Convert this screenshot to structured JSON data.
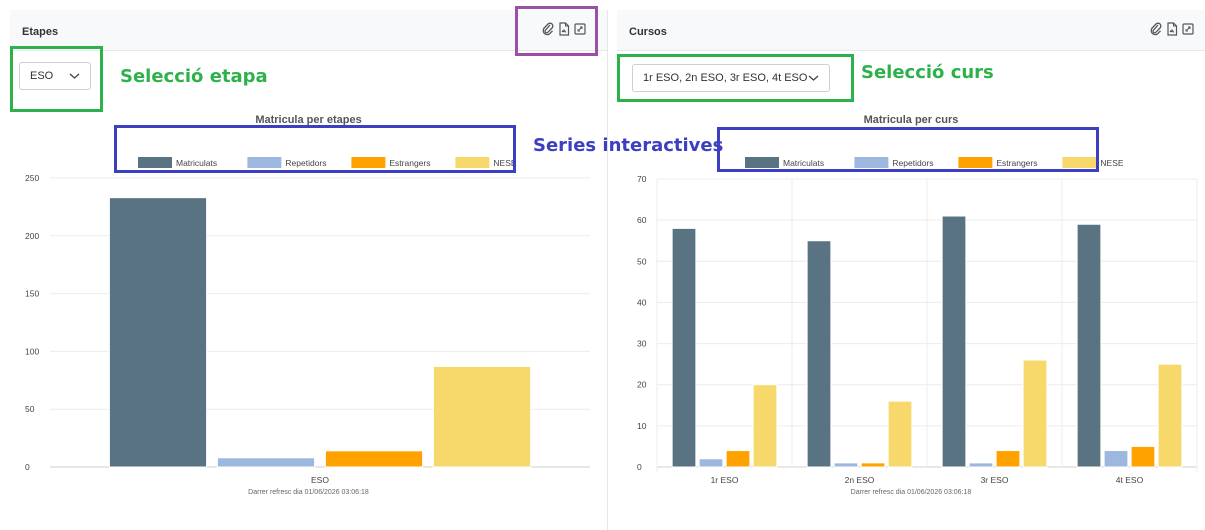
{
  "left": {
    "title": "Etapes",
    "select_value": "ESO",
    "chart_title": "Matricula per etapes",
    "footer": "Darrer refresc dia 01/06/2026 03:06:18"
  },
  "right": {
    "title": "Cursos",
    "select_value": "1r ESO, 2n ESO, 3r ESO, 4t ESO",
    "chart_title": "Matricula per curs",
    "footer": "Darrer refresc dia 01/06/2026 03:06:18"
  },
  "annotations": {
    "etapa": "Selecció etapa",
    "curs": "Selecció curs",
    "series": "Series interactives"
  },
  "icons": [
    "paperclip-icon",
    "pdf-icon",
    "expand-icon"
  ],
  "colors": {
    "Matriculats": "#5a7382",
    "Repetidors": "#9db7de",
    "Estrangers": "#ffa200",
    "NESE": "#f7d96b",
    "annot_green": "#2db24b",
    "annot_blue": "#3b3fc0",
    "annot_purple": "#9b4fa8"
  },
  "chart_data": [
    {
      "type": "bar",
      "title": "Matricula per etapes",
      "categories": [
        "ESO"
      ],
      "series": [
        {
          "name": "Matriculats",
          "values": [
            233
          ]
        },
        {
          "name": "Repetidors",
          "values": [
            8
          ]
        },
        {
          "name": "Estrangers",
          "values": [
            14
          ]
        },
        {
          "name": "NESE",
          "values": [
            87
          ]
        }
      ],
      "ylim": [
        0,
        250
      ],
      "yticks": [
        0,
        50,
        100,
        150,
        200,
        250
      ],
      "legend": "top",
      "grid": true
    },
    {
      "type": "bar",
      "title": "Matricula per curs",
      "categories": [
        "1r ESO",
        "2n ESO",
        "3r ESO",
        "4t ESO"
      ],
      "series": [
        {
          "name": "Matriculats",
          "values": [
            58,
            55,
            61,
            59
          ]
        },
        {
          "name": "Repetidors",
          "values": [
            2,
            1,
            1,
            4
          ]
        },
        {
          "name": "Estrangers",
          "values": [
            4,
            1,
            4,
            5
          ]
        },
        {
          "name": "NESE",
          "values": [
            20,
            16,
            26,
            25
          ]
        }
      ],
      "ylim": [
        0,
        70
      ],
      "yticks": [
        0,
        10,
        20,
        30,
        40,
        50,
        60,
        70
      ],
      "legend": "top",
      "grid": true
    }
  ]
}
